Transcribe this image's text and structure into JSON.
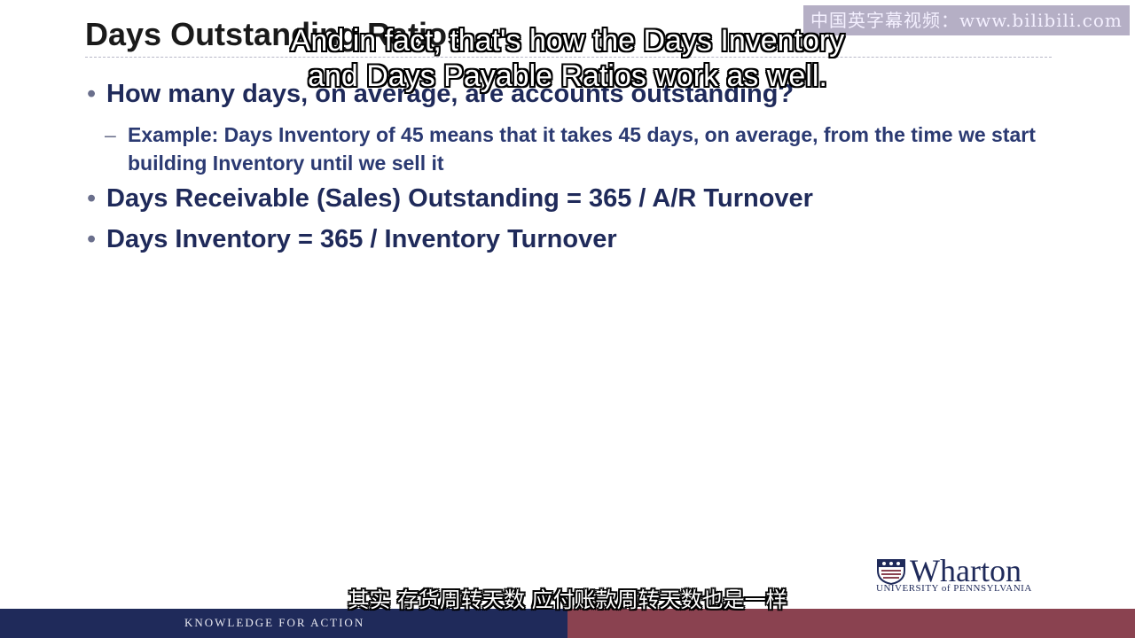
{
  "slide": {
    "title": "Days Outstanding Ratios",
    "bullets": [
      "How many days, on average, are accounts outstanding?",
      "Days Receivable (Sales) Outstanding = 365 / A/R Turnover",
      "Days Inventory = 365 / Inventory Turnover"
    ],
    "sub_bullet": "Example: Days Inventory of 45 means that it takes 45 days, on average, from the time we start building Inventory until we sell it"
  },
  "subtitles": {
    "english_line1": "And in fact, that's how the Days Inventory",
    "english_line2": "and Days Payable Ratios work as well.",
    "chinese": "其实 存货周转天数 应付账款周转天数也是一样"
  },
  "watermark": "中国英字幕视频：www.bilibili.com",
  "logo": {
    "name": "Wharton",
    "university": "UNIVERSITY of PENNSYLVANIA",
    "icon": "penn-shield-icon"
  },
  "footer": {
    "tagline": "KNOWLEDGE FOR ACTION",
    "colors": {
      "left": "#1f2a5a",
      "right": "#8a4250"
    }
  }
}
